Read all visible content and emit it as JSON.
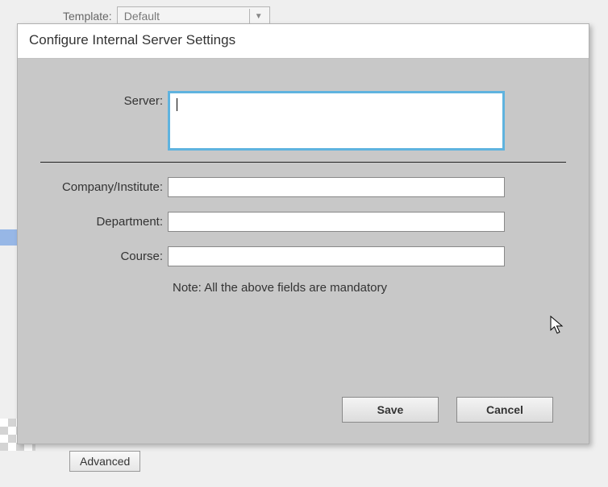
{
  "background": {
    "template_label": "Template:",
    "template_value": "Default",
    "advanced_label": "Advanced"
  },
  "dialog": {
    "title": "Configure Internal Server Settings",
    "fields": {
      "server_label": "Server:",
      "server_value": "",
      "company_label": "Company/Institute:",
      "company_value": "",
      "department_label": "Department:",
      "department_value": "",
      "course_label": "Course:",
      "course_value": ""
    },
    "note": "Note: All the above fields are mandatory",
    "buttons": {
      "save": "Save",
      "cancel": "Cancel"
    }
  }
}
